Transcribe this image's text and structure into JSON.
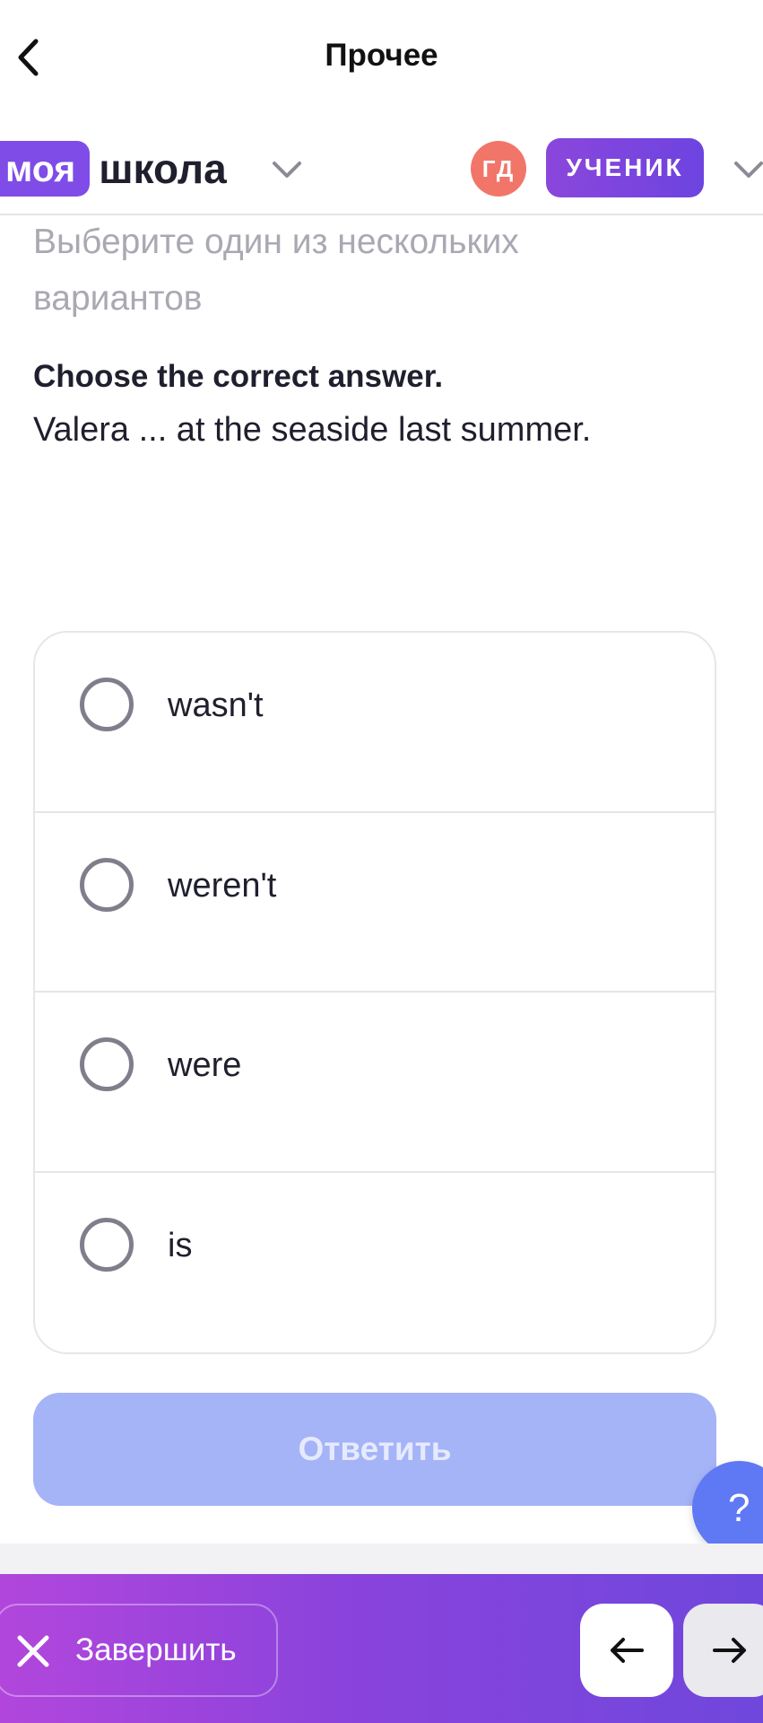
{
  "topbar": {
    "title": "Прочее",
    "back_icon": "chevron-left-icon"
  },
  "school": {
    "logo_part1": "моя",
    "logo_part2": "школа",
    "avatar_initials": "ГД",
    "role": "УЧЕНИК"
  },
  "task": {
    "hint": "Выберите один из нескольких вариантов",
    "title": "Choose the correct answer.",
    "text": "Valera ... at the seaside last summer."
  },
  "options": [
    {
      "label": "wasn't",
      "selected": false
    },
    {
      "label": "weren't",
      "selected": false
    },
    {
      "label": "were",
      "selected": false
    },
    {
      "label": "is",
      "selected": false
    }
  ],
  "answer_button": {
    "label": "Ответить",
    "enabled": false
  },
  "help": {
    "label": "?"
  },
  "bottom": {
    "finish_label": "Завершить"
  },
  "colors": {
    "accent": "#7f4ce8",
    "avatar": "#f2756a",
    "answer_disabled": "#a5b4f7",
    "help": "#5f78f4"
  }
}
